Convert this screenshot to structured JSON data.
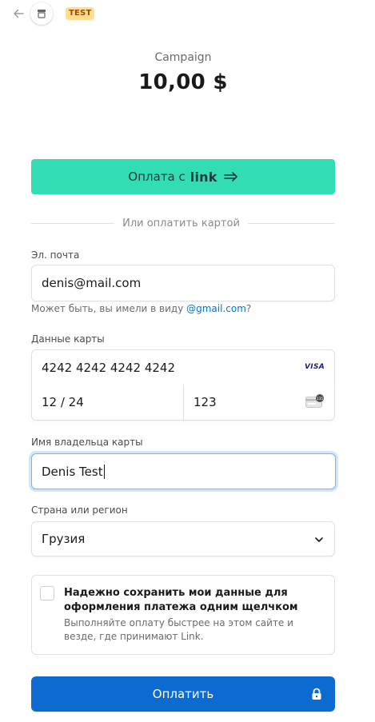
{
  "header": {
    "badge": "TEST",
    "product_name": "Campaign",
    "amount": "10,00 $"
  },
  "icons": {
    "back": "back-arrow-icon",
    "merchant": "store-icon",
    "visa": "visa-icon",
    "cvc": "card-cvc-icon",
    "chevron": "chevron-down-icon",
    "lock": "lock-icon",
    "link_arrow": "double-arrow-icon"
  },
  "link_button": {
    "label": "Оплата с",
    "brand": "link",
    "color": "#33ddb3"
  },
  "divider": {
    "text": "Или оплатить картой"
  },
  "email": {
    "label": "Эл. почта",
    "value": "denis@mail.com",
    "hint_prefix": "Может быть, вы имели в виду ",
    "hint_suggestion": "@gmail.com",
    "hint_suffix": "?"
  },
  "card": {
    "label": "Данные карты",
    "number": "4242 4242 4242 4242",
    "brand_badge": "VISA",
    "expiry": "12 / 24",
    "cvc": "123"
  },
  "cardholder": {
    "label": "Имя владельца карты",
    "value": "Denis Test"
  },
  "country": {
    "label": "Страна или регион",
    "value": "Грузия"
  },
  "save_info": {
    "title": "Надежно сохранить мои данные для оформления платежа одним щелчком",
    "description": "Выполняйте оплату быстрее на этом сайте и везде, где принимают Link.",
    "checked": false
  },
  "pay_button": {
    "label": "Оплатить",
    "color": "#0c6ad1"
  }
}
